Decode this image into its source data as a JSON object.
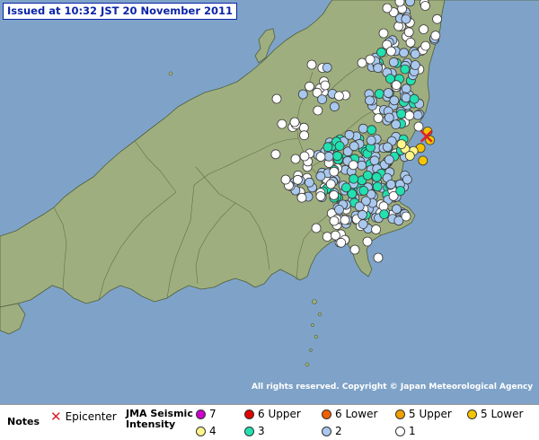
{
  "issued_text": "Issued at 10:32 JST  20 November 2011",
  "copyright_text": "All rights reserved. Copyright © Japan Meteorological Agency",
  "colors": {
    "sea": "#7fa3c8",
    "land": "#9fae7e",
    "border": "#5a6b42",
    "epicenter": "#e0202a",
    "intensity": {
      "7": "#cc00cc",
      "6U": "#e00000",
      "6L": "#f06000",
      "5U": "#f0a000",
      "5L": "#f5c400",
      "4": "#fff58a",
      "3": "#22e0b0",
      "2": "#a9c8ee",
      "1": "#ffffff"
    }
  },
  "legend": {
    "notes_label": "Notes",
    "epicenter_label": "Epicenter",
    "scale_title_line1": "JMA Seismic",
    "scale_title_line2": "Intensity",
    "labels": {
      "i7": "7",
      "i6u": "6 Upper",
      "i6l": "6 Lower",
      "i5u": "5 Upper",
      "i5l": "5 Lower",
      "i4": "4",
      "i3": "3",
      "i2": "2",
      "i1": "1"
    }
  },
  "map_data": {
    "epicenter": {
      "lon": 140.6,
      "lat": 36.7
    },
    "max_intensity": "5 Lower",
    "stations": [
      {
        "lon": 140.61,
        "lat": 36.75,
        "i": "5L"
      },
      {
        "lon": 140.63,
        "lat": 36.66,
        "i": "5L"
      },
      {
        "lon": 140.55,
        "lat": 36.58,
        "i": "5L"
      },
      {
        "lon": 140.57,
        "lat": 36.45,
        "i": "5L"
      },
      {
        "lon": 140.49,
        "lat": 36.55,
        "i": "4"
      },
      {
        "lon": 140.42,
        "lat": 36.57,
        "i": "4"
      },
      {
        "lon": 140.46,
        "lat": 36.5,
        "i": "4"
      },
      {
        "lon": 140.39,
        "lat": 36.62,
        "i": "4"
      }
    ]
  }
}
